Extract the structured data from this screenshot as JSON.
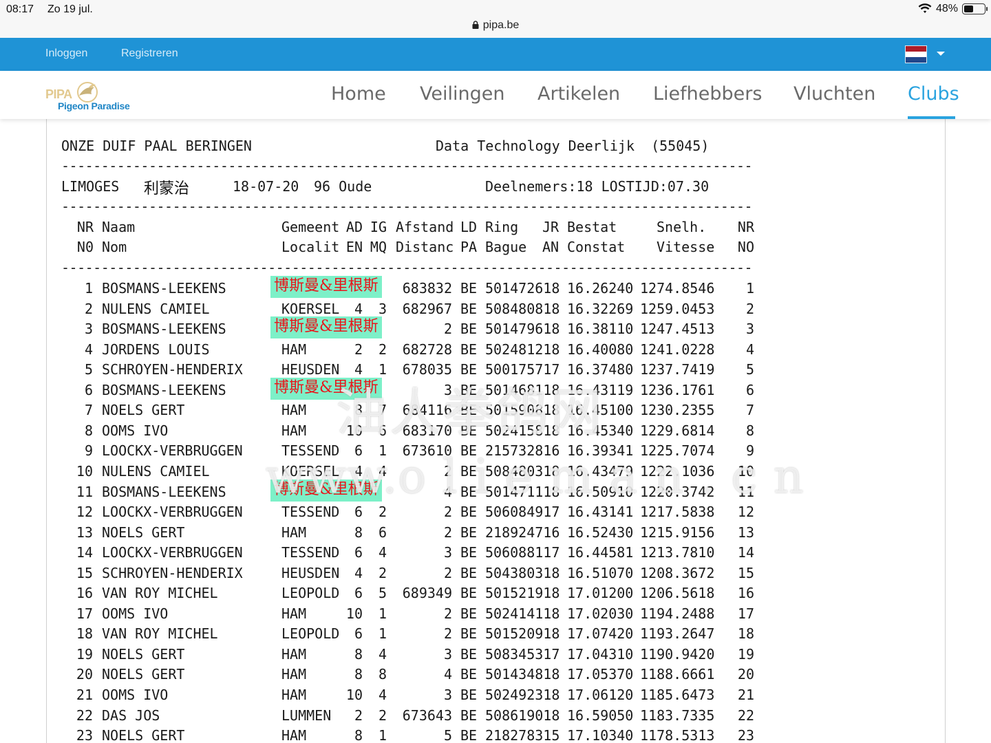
{
  "status_bar": {
    "time": "08:17",
    "date": "Zo 19 jul.",
    "url": "pipa.be",
    "battery": "48%",
    "battery_level": 0.48
  },
  "top_bar": {
    "login": "Inloggen",
    "register": "Registreren",
    "language_flag": "netherlands-flag"
  },
  "logo": {
    "brand": "PIPA",
    "tagline": "Pigeon Paradise"
  },
  "nav": {
    "items": [
      "Home",
      "Veilingen",
      "Artikelen",
      "Liefhebbers",
      "Vluchten",
      "Clubs"
    ],
    "active": "Clubs"
  },
  "report": {
    "club": "ONZE DUIF PAAL BERINGEN",
    "provider": "Data Technology Deerlijk  (55045)",
    "race": "LIMOGES",
    "race_cjk": "利蒙治",
    "date": "18-07-20",
    "category": "96 Oude",
    "participants": "Deelnemers:18 LOSTIJD:07.30",
    "header1": [
      "NR",
      "Naam",
      "Gemeent",
      "AD",
      "IG",
      "Afstand",
      "LD",
      "Ring",
      "JR",
      "Bestat",
      "Snelh.",
      "NR"
    ],
    "header2": [
      "N0",
      "Nom",
      "Localit",
      "EN",
      "MQ",
      "Distanc",
      "PA",
      "Bague",
      "AN",
      "Constat",
      "Vitesse",
      "NO"
    ],
    "rows": [
      {
        "nr": "1",
        "naam": "BOSMANS-LEEKENS",
        "gem": "",
        "gem_cjk": "博斯曼&里根斯",
        "ad": "",
        "ig": "",
        "afs": "683832",
        "ld": "BE",
        "ring": "501472618",
        "bestat": "16.26240",
        "snelh": "1274.8546",
        "no": "1"
      },
      {
        "nr": "2",
        "naam": "NULENS CAMIEL",
        "gem": "KOERSEL",
        "gem_cjk": "",
        "ad": "4",
        "ig": "3",
        "afs": "682967",
        "ld": "BE",
        "ring": "508480818",
        "bestat": "16.32269",
        "snelh": "1259.0453",
        "no": "2"
      },
      {
        "nr": "3",
        "naam": "BOSMANS-LEEKENS",
        "gem": "",
        "gem_cjk": "博斯曼&里根斯",
        "ad": "",
        "ig": "",
        "afs": "2",
        "ld": "BE",
        "ring": "501479618",
        "bestat": "16.38110",
        "snelh": "1247.4513",
        "no": "3"
      },
      {
        "nr": "4",
        "naam": "JORDENS LOUIS",
        "gem": "HAM",
        "gem_cjk": "",
        "ad": "2",
        "ig": "2",
        "afs": "682728",
        "ld": "BE",
        "ring": "502481218",
        "bestat": "16.40080",
        "snelh": "1241.0228",
        "no": "4"
      },
      {
        "nr": "5",
        "naam": "SCHROYEN-HENDERIX",
        "gem": "HEUSDEN",
        "gem_cjk": "",
        "ad": "4",
        "ig": "1",
        "afs": "678035",
        "ld": "BE",
        "ring": "500175717",
        "bestat": "16.37480",
        "snelh": "1237.7419",
        "no": "5"
      },
      {
        "nr": "6",
        "naam": "BOSMANS-LEEKENS",
        "gem": "",
        "gem_cjk": "博斯曼&里根斯",
        "ad": "",
        "ig": "",
        "afs": "3",
        "ld": "BE",
        "ring": "501468118",
        "bestat": "16.43119",
        "snelh": "1236.1761",
        "no": "6"
      },
      {
        "nr": "7",
        "naam": "NOELS GERT",
        "gem": "HAM",
        "gem_cjk": "",
        "ad": "8",
        "ig": "7",
        "afs": "684116",
        "ld": "BE",
        "ring": "501590818",
        "bestat": "16.45100",
        "snelh": "1230.2355",
        "no": "7"
      },
      {
        "nr": "8",
        "naam": "OOMS IVO",
        "gem": "HAM",
        "gem_cjk": "",
        "ad": "10",
        "ig": "6",
        "afs": "683170",
        "ld": "BE",
        "ring": "502415818",
        "bestat": "16.45340",
        "snelh": "1229.6814",
        "no": "8"
      },
      {
        "nr": "9",
        "naam": "LOOCKX-VERBRUGGEN",
        "gem": "TESSEND",
        "gem_cjk": "",
        "ad": "6",
        "ig": "1",
        "afs": "673610",
        "ld": "BE",
        "ring": "215732816",
        "bestat": "16.39341",
        "snelh": "1225.7074",
        "no": "9"
      },
      {
        "nr": "10",
        "naam": "NULENS CAMIEL",
        "gem": "KOERSEL",
        "gem_cjk": "",
        "ad": "4",
        "ig": "4",
        "afs": "2",
        "ld": "BE",
        "ring": "508480318",
        "bestat": "16.43479",
        "snelh": "1222.1036",
        "no": "10"
      },
      {
        "nr": "11",
        "naam": "BOSMANS-LEEKENS",
        "gem": "",
        "gem_cjk": "博斯曼&里根斯",
        "ad": "",
        "ig": "",
        "afs": "4",
        "ld": "BE",
        "ring": "501471118",
        "bestat": "16.50910",
        "snelh": "1220.3742",
        "no": "11"
      },
      {
        "nr": "12",
        "naam": "LOOCKX-VERBRUGGEN",
        "gem": "TESSEND",
        "gem_cjk": "",
        "ad": "6",
        "ig": "2",
        "afs": "2",
        "ld": "BE",
        "ring": "506084917",
        "bestat": "16.43141",
        "snelh": "1217.5838",
        "no": "12"
      },
      {
        "nr": "13",
        "naam": "NOELS GERT",
        "gem": "HAM",
        "gem_cjk": "",
        "ad": "8",
        "ig": "6",
        "afs": "2",
        "ld": "BE",
        "ring": "218924716",
        "bestat": "16.52430",
        "snelh": "1215.9156",
        "no": "13"
      },
      {
        "nr": "14",
        "naam": "LOOCKX-VERBRUGGEN",
        "gem": "TESSEND",
        "gem_cjk": "",
        "ad": "6",
        "ig": "4",
        "afs": "3",
        "ld": "BE",
        "ring": "506088117",
        "bestat": "16.44581",
        "snelh": "1213.7810",
        "no": "14"
      },
      {
        "nr": "15",
        "naam": "SCHROYEN-HENDERIX",
        "gem": "HEUSDEN",
        "gem_cjk": "",
        "ad": "4",
        "ig": "2",
        "afs": "2",
        "ld": "BE",
        "ring": "504380318",
        "bestat": "16.51070",
        "snelh": "1208.3672",
        "no": "15"
      },
      {
        "nr": "16",
        "naam": "VAN ROY MICHEL",
        "gem": "LEOPOLD",
        "gem_cjk": "",
        "ad": "6",
        "ig": "5",
        "afs": "689349",
        "ld": "BE",
        "ring": "501521918",
        "bestat": "17.01200",
        "snelh": "1206.5618",
        "no": "16"
      },
      {
        "nr": "17",
        "naam": "OOMS IVO",
        "gem": "HAM",
        "gem_cjk": "",
        "ad": "10",
        "ig": "1",
        "afs": "2",
        "ld": "BE",
        "ring": "502414118",
        "bestat": "17.02030",
        "snelh": "1194.2488",
        "no": "17"
      },
      {
        "nr": "18",
        "naam": "VAN ROY MICHEL",
        "gem": "LEOPOLD",
        "gem_cjk": "",
        "ad": "6",
        "ig": "1",
        "afs": "2",
        "ld": "BE",
        "ring": "501520918",
        "bestat": "17.07420",
        "snelh": "1193.2647",
        "no": "18"
      },
      {
        "nr": "19",
        "naam": "NOELS GERT",
        "gem": "HAM",
        "gem_cjk": "",
        "ad": "8",
        "ig": "4",
        "afs": "3",
        "ld": "BE",
        "ring": "508345317",
        "bestat": "17.04310",
        "snelh": "1190.9420",
        "no": "19"
      },
      {
        "nr": "20",
        "naam": "NOELS GERT",
        "gem": "HAM",
        "gem_cjk": "",
        "ad": "8",
        "ig": "8",
        "afs": "4",
        "ld": "BE",
        "ring": "501434818",
        "bestat": "17.05370",
        "snelh": "1188.6661",
        "no": "20"
      },
      {
        "nr": "21",
        "naam": "OOMS IVO",
        "gem": "HAM",
        "gem_cjk": "",
        "ad": "10",
        "ig": "4",
        "afs": "3",
        "ld": "BE",
        "ring": "502492318",
        "bestat": "17.06120",
        "snelh": "1185.6473",
        "no": "21"
      },
      {
        "nr": "22",
        "naam": "DAS JOS",
        "gem": "LUMMEN",
        "gem_cjk": "",
        "ad": "2",
        "ig": "2",
        "afs": "673643",
        "ld": "BE",
        "ring": "508619018",
        "bestat": "16.59050",
        "snelh": "1183.7335",
        "no": "22"
      },
      {
        "nr": "23",
        "naam": "NOELS GERT",
        "gem": "HAM",
        "gem_cjk": "",
        "ad": "8",
        "ig": "1",
        "afs": "5",
        "ld": "BE",
        "ring": "218278315",
        "bestat": "17.10340",
        "snelh": "1178.5313",
        "no": "23"
      }
    ]
  },
  "watermark": {
    "line1": "油人拳鸽网",
    "line2": "www.o l i e m a n . c n"
  },
  "colors": {
    "topbar": "#1f93d6",
    "nav_active": "#2aa3df",
    "highlight_bg": "#7df0c8",
    "highlight_text": "#e8161b"
  }
}
